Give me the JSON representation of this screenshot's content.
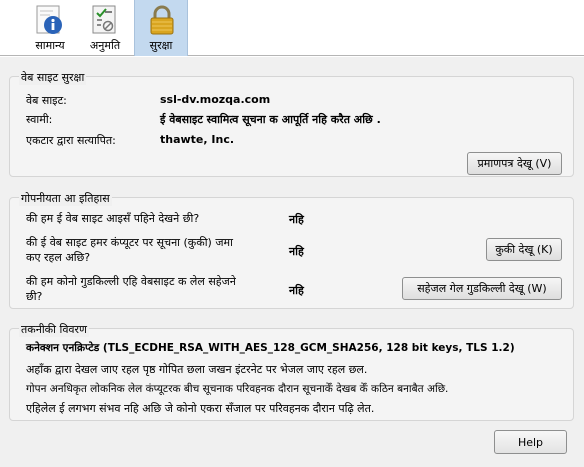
{
  "toolbar": {
    "items": [
      {
        "label": "सामान्य"
      },
      {
        "label": "अनुमति"
      },
      {
        "label": "सुरक्षा"
      }
    ]
  },
  "website_identity": {
    "title": "वेब साइट सुरक्षा",
    "website_label": "वेब साइट:",
    "website_value": "ssl-dv.mozqa.com",
    "owner_label": "स्वामी:",
    "owner_value": "ई वेबसाइट स्वामित्व सूचना क आपूर्ति नहि करैत  अछि .",
    "verifier_label": "एकटार द्वारा सत्यापित:",
    "verifier_value": "thawte, Inc.",
    "view_cert_button": "प्रमाणपत्र देखू (V)"
  },
  "privacy_history": {
    "title": "गोपनीयता आ इतिहास",
    "visited_question": "की हम ई वेब साइट आइसँ पहिने देखने छी?",
    "visited_answer": "नहि",
    "cookies_question_line1": "की ई वेब साइट हमर कंप्यूटर पर सूचना (कुकी) जमा",
    "cookies_question_line2": "कए रहल अछि?",
    "cookies_answer": "नहि",
    "cookies_button": "कुकी देखू (K)",
    "passwords_question_line1": "की हम कोनो गुडकिल्ली एहि वेबसाइट क लेल सहेजने",
    "passwords_question_line2": "छी?",
    "passwords_answer": "नहि",
    "passwords_button": "सहेजल गेल गुडकिल्ली देखू (W)"
  },
  "technical_details": {
    "title": "तकनीकी विवरण",
    "connection": "कनेक्शन एनक्रिप्टेड (TLS_ECDHE_RSA_WITH_AES_128_GCM_SHA256, 128 bit keys, TLS 1.2)",
    "line1": "अहाँक द्वारा देखल जाए रहल पृष्ठ गोपित छला जखन इंटरनेट पर भेजल जाए रहल छल.",
    "line2": "गोपन अनधिकृत लोकनिक लेल कंप्यूटरक बीच सूचनाक परिवहनक दौरान सूचनाकेँ देखब केँ कठिन बनाबैत अछि.",
    "line3": "एहिलेल ई लगभग संभव नहि अछि जे कोनो एकरा सँजाल पर परिवहनक दौरान पढ़ि लेत."
  },
  "footer": {
    "help_button": "Help"
  },
  "colors": {
    "selected_tab": "#c3d9ef",
    "info_icon": "#2a63b8",
    "lock_icon": "#d9a520"
  }
}
